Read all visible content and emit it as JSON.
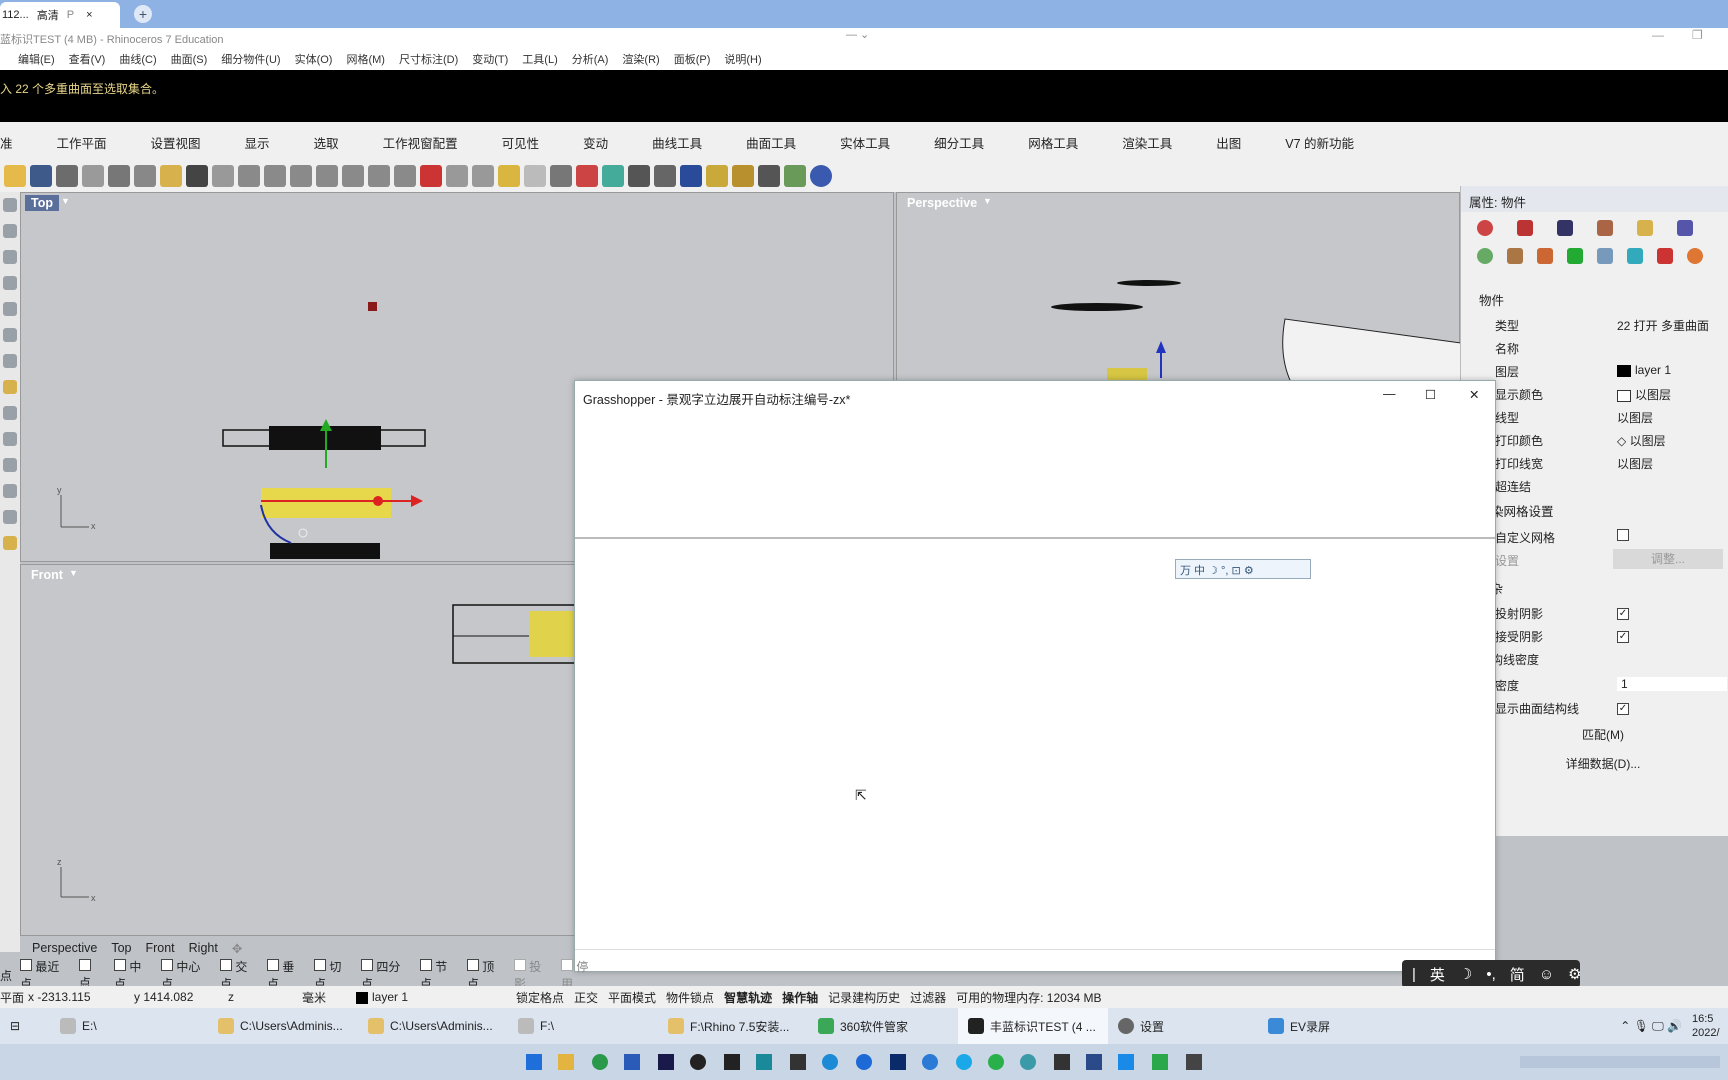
{
  "browser": {
    "tab_title": "112...",
    "tab_quality": "高清",
    "tab_p": "P",
    "tab_close": "×",
    "new_tab": "+"
  },
  "app": {
    "title": "蓝标识TEST (4 MB) - Rhinoceros 7 Education",
    "menu": [
      "编辑(E)",
      "查看(V)",
      "曲线(C)",
      "曲面(S)",
      "细分物件(U)",
      "实体(O)",
      "网格(M)",
      "尺寸标注(D)",
      "变动(T)",
      "工具(L)",
      "分析(A)",
      "渲染(R)",
      "面板(P)",
      "说明(H)"
    ],
    "command_output": "入 22 个多重曲面至选取集合。"
  },
  "toolbar_tabs": [
    "准",
    "工作平面",
    "设置视图",
    "显示",
    "选取",
    "工作视窗配置",
    "可见性",
    "变动",
    "曲线工具",
    "曲面工具",
    "实体工具",
    "细分工具",
    "网格工具",
    "渲染工具",
    "出图",
    "V7 的新功能"
  ],
  "viewports": {
    "top": {
      "label": "Top"
    },
    "perspective": {
      "label": "Perspective"
    },
    "front": {
      "label": "Front"
    }
  },
  "viewport_tabs": [
    "Perspective",
    "Top",
    "Front",
    "Right"
  ],
  "properties": {
    "title": "属性: 物件",
    "section": "物件",
    "rows": [
      {
        "label": "类型",
        "value": "22 打开 多重曲面"
      },
      {
        "label": "名称",
        "value": ""
      },
      {
        "label": "图层",
        "value": "layer 1"
      },
      {
        "label": "显示颜色",
        "value": "以图层"
      },
      {
        "label": "线型",
        "value": "以图层"
      },
      {
        "label": "打印颜色",
        "value": "以图层"
      },
      {
        "label": "打印线宽",
        "value": "以图层"
      },
      {
        "label": "超连结",
        "value": ""
      }
    ],
    "mesh_section": "染网格设置",
    "custom_mesh": "自定义网格",
    "settings": "设置",
    "adjust_btn": "调整...",
    "misc": "杂",
    "cast_shadow": "投射阴影",
    "receive_shadow": "接受阴影",
    "isocurve_density": "构线密度",
    "density": "密度",
    "density_value": "1",
    "show_structure": "显示曲面结构线",
    "match_btn": "匹配(M)",
    "details_btn": "详细数据(D)..."
  },
  "grasshopper": {
    "title": "Grasshopper - 景观字立边展开自动标注编号-zx*",
    "minimize": "—",
    "maximize": "☐",
    "close": "✕"
  },
  "osnap": [
    "点",
    "最近点",
    "点",
    "中点",
    "中心点",
    "交点",
    "垂点",
    "切点",
    "四分点",
    "节点",
    "顶点",
    "投影",
    "停用"
  ],
  "status": {
    "plane": "平面",
    "x": "x -2313.115",
    "y": "y 1414.082",
    "z": "z",
    "unit": "毫米",
    "layer": "layer 1",
    "items": [
      "锁定格点",
      "正交",
      "平面模式",
      "物件锁点",
      "智慧轨迹",
      "操作轴",
      "记录建构历史",
      "过滤器"
    ],
    "memory": "可用的物理内存: 12034 MB"
  },
  "ime": {
    "lang": "英",
    "simp": "简"
  },
  "taskbar": {
    "items": [
      "E:\\",
      "C:\\Users\\Adminis...",
      "C:\\Users\\Adminis...",
      "F:\\",
      "F:\\Rhino 7.5安装...",
      "360软件管家",
      "丰蓝标识TEST (4 ...",
      "设置",
      "EV录屏"
    ],
    "time": "16:5",
    "date": "2022/"
  }
}
